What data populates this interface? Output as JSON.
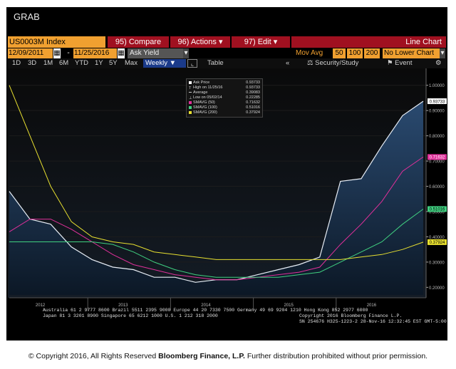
{
  "app_title": "GRAB",
  "toolbar": {
    "security": "US0003M Index",
    "compare": "95) Compare",
    "actions": "96) Actions",
    "edit": "97) Edit",
    "chart_type": "Line Chart"
  },
  "range": {
    "start": "12/09/2011",
    "dash": "-",
    "end": "11/25/2016",
    "field": "Ask Yield",
    "mov_avg_label": "Mov Avg",
    "mov_avg": [
      "50",
      "100",
      "200"
    ],
    "lower_chart": "No Lower Chart"
  },
  "tabs": [
    "1D",
    "3D",
    "1M",
    "6M",
    "YTD",
    "1Y",
    "5Y",
    "Max"
  ],
  "period": "Weekly",
  "table_label": "Table",
  "security_study": "Security/Study",
  "event_label": "Event",
  "legend": [
    {
      "label": "Ask Price",
      "value": "0.93733",
      "color": "#ffffff"
    },
    {
      "label": "High on 11/25/16",
      "value": "0.93733",
      "color": "#cccccc"
    },
    {
      "label": "Average",
      "value": "0.39083",
      "color": "#cccccc"
    },
    {
      "label": "Low on 05/02/14",
      "value": "0.22285",
      "color": "#cccccc"
    },
    {
      "label": "SMAVG (50)",
      "value": "0.71632",
      "color": "#e0309a"
    },
    {
      "label": "SMAVG (100)",
      "value": "0.51016",
      "color": "#40d080"
    },
    {
      "label": "SMAVG (200)",
      "value": "0.37924",
      "color": "#e8e030"
    }
  ],
  "chart_data": {
    "type": "area",
    "x": [
      "2012-01",
      "2012-04",
      "2012-07",
      "2012-10",
      "2013-01",
      "2013-04",
      "2013-07",
      "2013-10",
      "2014-01",
      "2014-04",
      "2014-07",
      "2014-10",
      "2015-01",
      "2015-04",
      "2015-07",
      "2015-10",
      "2016-01",
      "2016-04",
      "2016-07",
      "2016-10",
      "2016-11"
    ],
    "xticks": [
      "2012",
      "2013",
      "2014",
      "2015",
      "2016"
    ],
    "yticks": [
      "1.00000",
      "0.90000",
      "0.80000",
      "0.70000",
      "0.60000",
      "0.50000",
      "0.40000",
      "0.30000",
      "0.20000"
    ],
    "ylim": [
      0.17,
      1.05
    ],
    "series": [
      {
        "name": "Ask Price",
        "values": [
          0.58,
          0.47,
          0.45,
          0.36,
          0.31,
          0.28,
          0.27,
          0.24,
          0.24,
          0.22,
          0.23,
          0.23,
          0.25,
          0.27,
          0.29,
          0.32,
          0.62,
          0.63,
          0.76,
          0.88,
          0.937
        ]
      },
      {
        "name": "SMAVG (50)",
        "values": [
          0.42,
          0.47,
          0.47,
          0.43,
          0.38,
          0.33,
          0.29,
          0.27,
          0.25,
          0.24,
          0.23,
          0.23,
          0.24,
          0.25,
          0.26,
          0.28,
          0.37,
          0.45,
          0.54,
          0.66,
          0.716
        ]
      },
      {
        "name": "SMAVG (100)",
        "values": [
          0.38,
          0.38,
          0.38,
          0.38,
          0.38,
          0.37,
          0.34,
          0.3,
          0.27,
          0.25,
          0.24,
          0.24,
          0.24,
          0.24,
          0.25,
          0.26,
          0.3,
          0.34,
          0.38,
          0.45,
          0.51
        ]
      },
      {
        "name": "SMAVG (200)",
        "values": [
          1.0,
          0.8,
          0.6,
          0.46,
          0.4,
          0.38,
          0.37,
          0.34,
          0.33,
          0.32,
          0.31,
          0.31,
          0.31,
          0.31,
          0.31,
          0.31,
          0.31,
          0.32,
          0.33,
          0.35,
          0.379
        ]
      }
    ],
    "last_labels": [
      {
        "value": "0.93733",
        "y": 0.937,
        "bg": "#ffffff",
        "fg": "#000000"
      },
      {
        "value": "0.71632",
        "y": 0.716,
        "bg": "#e0309a",
        "fg": "#ffffff"
      },
      {
        "value": "0.51016",
        "y": 0.51,
        "bg": "#40d080",
        "fg": "#000000"
      },
      {
        "value": "0.37924",
        "y": 0.379,
        "bg": "#e8e030",
        "fg": "#000000"
      }
    ]
  },
  "footer": {
    "line1": "Australia 61 2 9777 8600 Brazil 5511 2395 9000 Europe 44 20 7330 7500 Germany 49 69 9204 1210 Hong Kong 852 2977 6000",
    "line2": "Japan 81 3 3201 8900        Singapore 65 6212 1000        U.S. 1 212 318 2000",
    "line3": "Copyright 2016 Bloomberg Finance L.P.",
    "line4": "SN 254676 H325-1223-2 28-Nov-16 12:32:45 EST  GMT-5:00"
  },
  "copyright": {
    "pre": "© Copyright 2016, All Rights Reserved",
    "bold": "Bloomberg Finance, L.P.",
    "post": "Further distribution prohibited without prior permission."
  }
}
